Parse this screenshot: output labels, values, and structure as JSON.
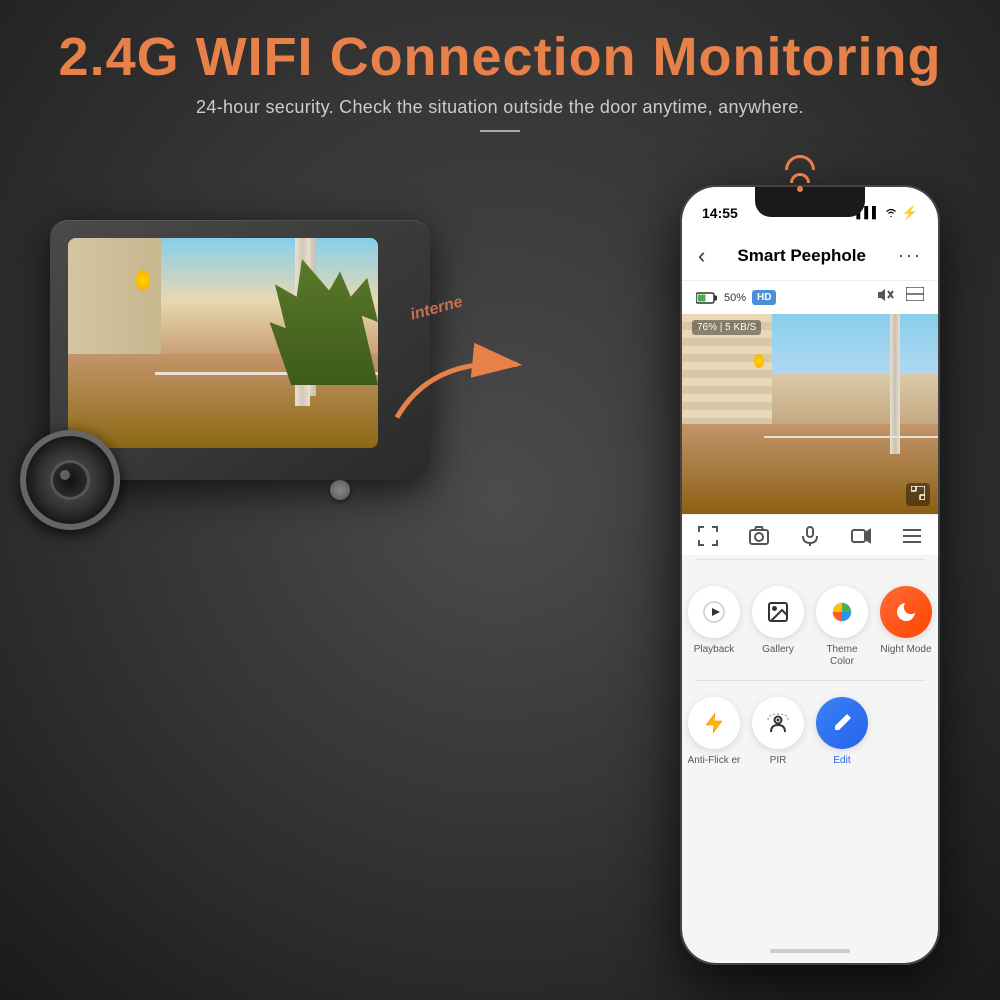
{
  "header": {
    "main_title": "2.4G WIFI Connection Monitoring",
    "sub_title": "24-hour security. Check the situation outside the door anytime, anywhere."
  },
  "arrow_label": "interne",
  "phone": {
    "status_bar": {
      "time": "14:55",
      "signal": "▌▌▌",
      "wifi": "WiFi",
      "battery": "⚡"
    },
    "app_bar": {
      "back_icon": "‹",
      "title": "Smart Peephole",
      "more_icon": "···"
    },
    "camera_info": {
      "battery_percent": "50%",
      "hd_label": "HD",
      "mute_icon": "🔇",
      "fullscreen_icon": "⊟",
      "signal_text": "76% | 5 KB/S"
    },
    "controls": {
      "fullscreen": "⛶",
      "screenshot": "📷",
      "mic": "🎤",
      "record": "▶",
      "menu": "☰"
    },
    "menu_items": [
      {
        "id": "playback",
        "icon": "▶",
        "label": "Playback",
        "icon_type": "play"
      },
      {
        "id": "gallery",
        "icon": "🖼",
        "label": "Gallery",
        "icon_type": "gallery"
      },
      {
        "id": "theme_color",
        "icon": "🎨",
        "label": "Theme\nColor",
        "icon_type": "theme"
      },
      {
        "id": "night_mode",
        "icon": "☾",
        "label": "Night\nMode",
        "icon_type": "night"
      },
      {
        "id": "anti_flicker",
        "icon": "⚡",
        "label": "Anti-Flick\ner",
        "icon_type": "flicker"
      },
      {
        "id": "pir",
        "icon": "👁",
        "label": "PIR",
        "icon_type": "pir"
      },
      {
        "id": "edit",
        "icon": "✏",
        "label": "Edit",
        "icon_type": "edit"
      }
    ]
  },
  "wifi_icon": {
    "color": "#e8804a"
  }
}
